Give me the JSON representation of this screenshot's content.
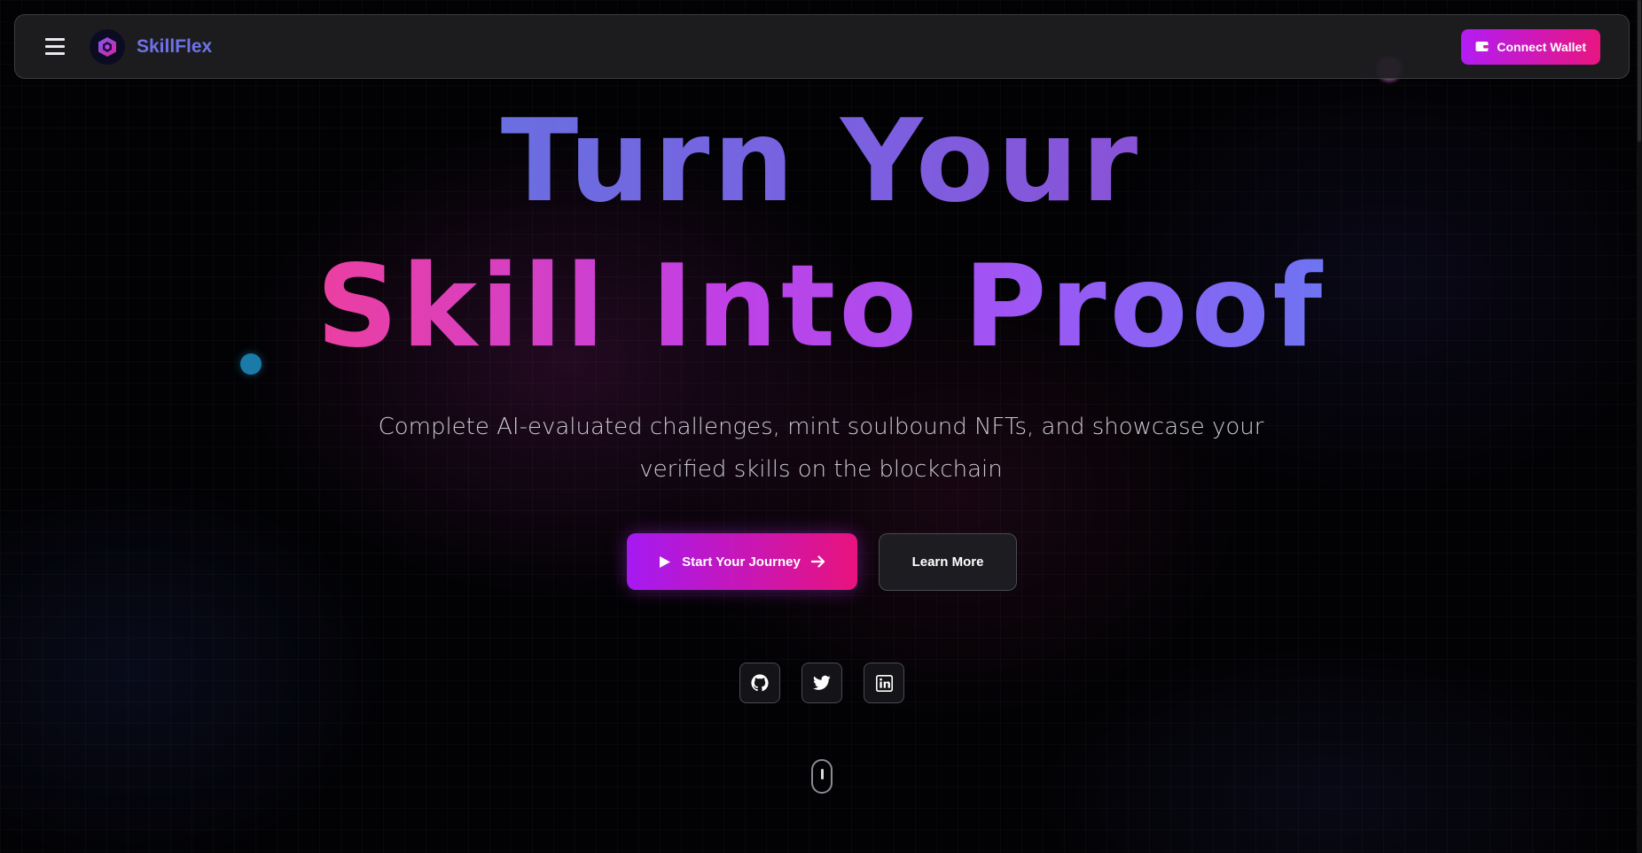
{
  "navbar": {
    "brand": "SkillFlex",
    "menu_icon": "hamburger-menu-icon",
    "logo_icon": "cube-logo-icon",
    "connect_wallet_label": "Connect Wallet",
    "connect_wallet_icon": "wallet-icon"
  },
  "hero": {
    "headline_line1": "Turn Your",
    "headline_line2": "Skill Into Proof",
    "subtitle_line1": "Complete AI-evaluated challenges, mint soulbound NFTs, and showcase your",
    "subtitle_line2": "verified skills on the blockchain",
    "primary_cta_label": "Start Your Journey",
    "primary_cta_icons": [
      "play-icon",
      "arrow-right-icon"
    ],
    "secondary_cta_label": "Learn More"
  },
  "social": [
    {
      "name": "GitHub",
      "icon": "github-icon"
    },
    {
      "name": "Twitter",
      "icon": "twitter-icon"
    },
    {
      "name": "LinkedIn",
      "icon": "linkedin-icon"
    }
  ],
  "colors": {
    "background": "#020204",
    "accent_purple": "#a51af2",
    "accent_pink": "#e8137d",
    "brand_text": "#6e72e8",
    "headline_line1_gradient": [
      "#6a6ee0",
      "#8a52d6"
    ],
    "headline_line2_gradient": [
      "#ec3fa0",
      "#c040e6",
      "#6e74f2"
    ]
  }
}
